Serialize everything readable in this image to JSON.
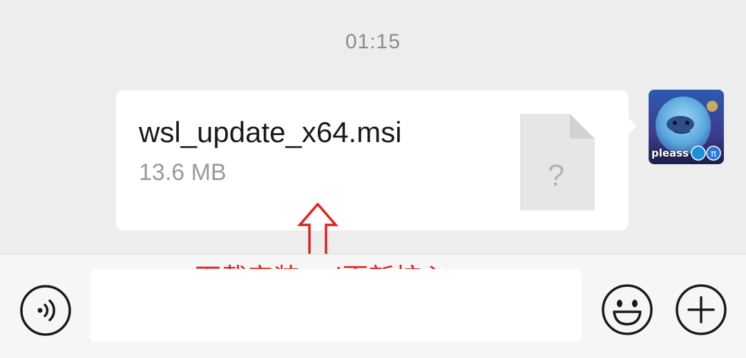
{
  "chat": {
    "timestamp": "01:15",
    "message": {
      "file_name": "wsl_update_x64.msi",
      "file_size": "13.6 MB",
      "file_icon": "unknown-file-icon",
      "file_icon_glyph": "?"
    },
    "avatar": {
      "caption": "pleass"
    }
  },
  "annotation": {
    "text": "下载安装wsl更新核心",
    "color": "#e0211c"
  },
  "input_bar": {
    "voice_icon": "voice-icon",
    "emoji_icon": "emoji-icon",
    "plus_icon": "plus-icon",
    "input_value": ""
  }
}
